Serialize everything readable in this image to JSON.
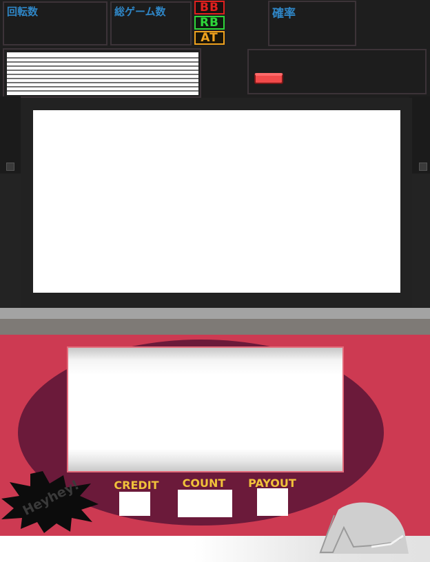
{
  "stats": {
    "spins_label": "回転数",
    "total_games_label": "総ゲーム数",
    "probability_label": "確率"
  },
  "bonus": {
    "bb": "BB",
    "rb": "RB",
    "at": "AT",
    "bb_color": "#e0201e",
    "rb_color": "#2ed73a",
    "at_color": "#f0a21e"
  },
  "counters": {
    "credit_label": "CREDIT",
    "count_label": "COUNT",
    "payout_label": "PAYOUT"
  },
  "badge": {
    "text": "Heyhey!"
  },
  "colors": {
    "cabinet_red": "#cd3a52",
    "oval": "#6b1a3a",
    "counter_label": "#f0c23a"
  }
}
